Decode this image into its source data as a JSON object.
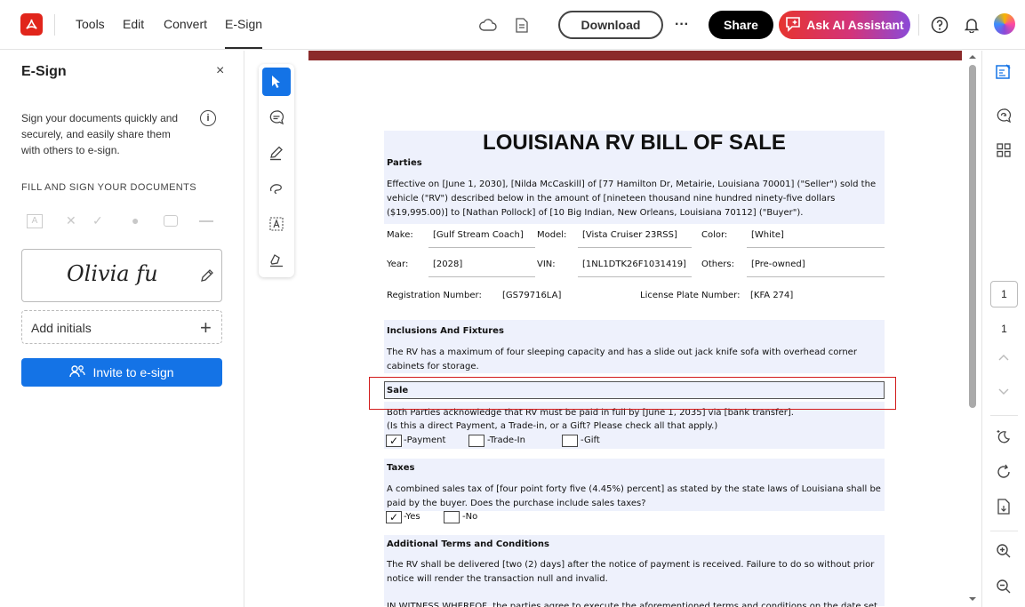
{
  "header": {
    "menu": [
      "Tools",
      "Edit",
      "Convert",
      "E-Sign"
    ],
    "active_menu": "E-Sign",
    "download_label": "Download",
    "more_label": "···",
    "share_label": "Share",
    "ai_label": "Ask AI Assistant"
  },
  "panel": {
    "title": "E-Sign",
    "close": "×",
    "description": "Sign your documents quickly and securely, and easily share them with others to e-sign.",
    "section_label": "FILL AND SIGN YOUR DOCUMENTS",
    "signature_text": "Olivia fu",
    "initials_label": "Add initials",
    "invite_label": "Invite to e-sign"
  },
  "document": {
    "title": "LOUISIANA RV BILL OF SALE",
    "parties_heading": "Parties",
    "parties_text": "Effective on [June 1, 2030], [Nilda McCaskill] of [77 Hamilton Dr, Metairie, Louisiana 70001] (\"Seller\") sold the vehicle (\"RV\") described below in the amount of [nineteen thousand nine hundred ninety-five dollars ($19,995.00)] to [Nathan Pollock] of [10 Big Indian, New Orleans, Louisiana 70112] (\"Buyer\").",
    "make_label": "Make:",
    "make_value": "[Gulf Stream Coach]",
    "model_label": "Model:",
    "model_value": "[Vista Cruiser 23RSS]",
    "color_label": "Color:",
    "color_value": "[White]",
    "year_label": "Year:",
    "year_value": "[2028]",
    "vin_label": "VIN:",
    "vin_value": "[1NL1DTK26F1031419]",
    "others_label": "Others:",
    "others_value": "[Pre-owned]",
    "reg_label": "Registration Number:",
    "reg_value": "[GS79716LA]",
    "plate_label": "License Plate Number:",
    "plate_value": "[KFA 274]",
    "inclusions_heading": "Inclusions And Fixtures",
    "inclusions_text": "The RV has a maximum of four sleeping capacity and has a slide out jack knife sofa with overhead corner cabinets for storage.",
    "sale_heading": "Sale",
    "sale_text1": "Both Parties acknowledge that RV must be paid in full by [June 1, 2035] via [bank transfer].",
    "sale_text2": "(Is this a direct Payment, a Trade-in, or a Gift? Please check all that apply.)",
    "opt_payment": "-Payment",
    "opt_tradein": "-Trade-In",
    "opt_gift": "-Gift",
    "taxes_heading": "Taxes",
    "taxes_text": "A combined sales tax of [four point forty five (4.45%) percent] as stated by the state laws of Louisiana shall be paid by the buyer. Does the purchase include sales taxes?",
    "opt_yes": "-Yes",
    "opt_no": "-No",
    "terms_heading": "Additional Terms and Conditions",
    "terms_text": "The RV shall be delivered [two (2) days] after the notice of payment is received. Failure to do so without prior notice will render the transaction null and invalid.",
    "witness_text": "IN WITNESS WHEREOF, the parties agree to execute the aforementioned terms and conditions on the date set",
    "check_mark": "✓"
  },
  "pager": {
    "current": "1",
    "total": "1"
  },
  "colors": {
    "accent": "#1473e6",
    "brand": "#e1251b",
    "selection": "#d21b1b",
    "doc_bar": "#8b2a2a"
  }
}
